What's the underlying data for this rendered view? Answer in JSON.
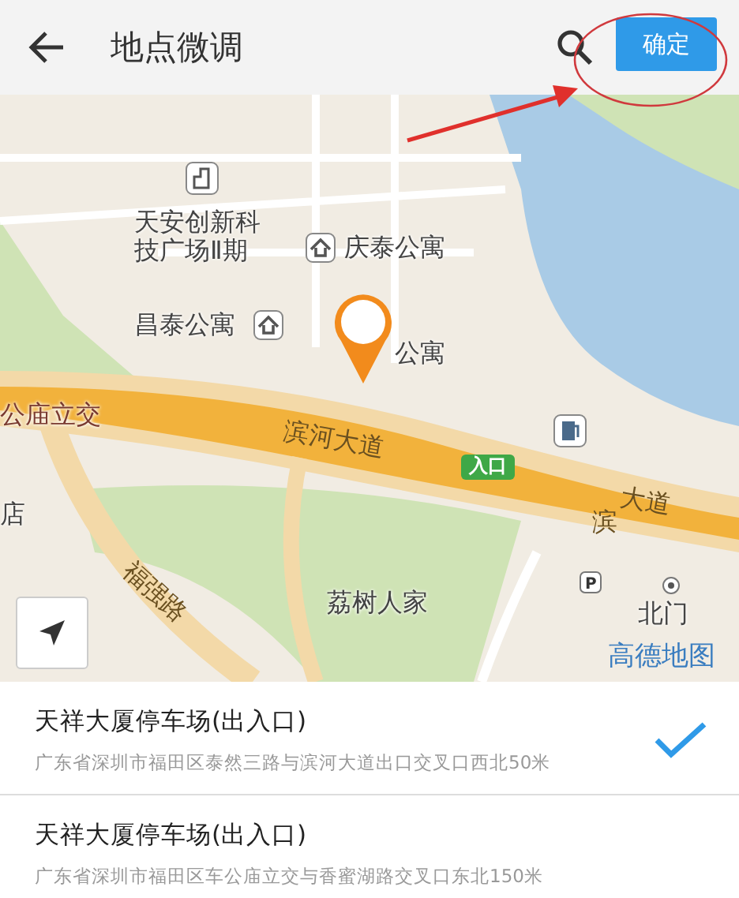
{
  "header": {
    "title": "地点微调",
    "confirm_button": "确定"
  },
  "map": {
    "labels": [
      {
        "kind": "poi",
        "text": "天安创新科技广场Ⅱ期"
      },
      {
        "kind": "home",
        "text": "庆泰公寓"
      },
      {
        "kind": "home",
        "text": "昌泰公寓"
      },
      {
        "kind": "poi",
        "text": "公寓"
      },
      {
        "kind": "junction",
        "text": "公庙立交"
      },
      {
        "kind": "road",
        "text": "滨河大道"
      },
      {
        "kind": "badge",
        "text": "入口"
      },
      {
        "kind": "poi",
        "text": "店"
      },
      {
        "kind": "road",
        "text": "福强路"
      },
      {
        "kind": "road",
        "text": "滨"
      },
      {
        "kind": "road",
        "text": "大道"
      },
      {
        "kind": "poi",
        "text": "荔树人家"
      },
      {
        "kind": "poi",
        "text": "北门"
      },
      {
        "kind": "logo",
        "text": "高德地图"
      }
    ],
    "parking_sign": "P"
  },
  "results": [
    {
      "name": "天祥大厦停车场(出入口)",
      "address": "广东省深圳市福田区泰然三路与滨河大道出口交叉口西北50米",
      "selected": true
    },
    {
      "name": "天祥大厦停车场(出入口)",
      "address": "广东省深圳市福田区车公庙立交与香蜜湖路交叉口东北150米",
      "selected": false
    }
  ]
}
